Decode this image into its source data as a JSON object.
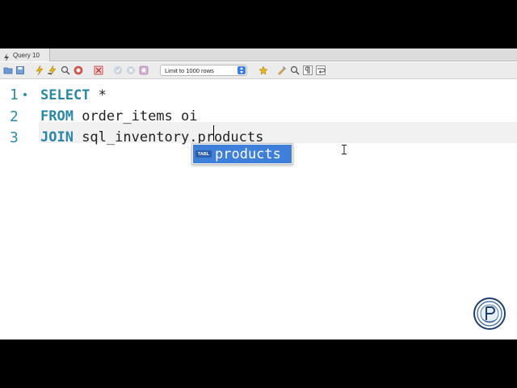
{
  "tab": {
    "label": "Query 10"
  },
  "toolbar": {
    "limit_value": "Limit to 1000 rows",
    "icons": [
      "folder-open-icon",
      "save-icon",
      "execute-icon",
      "execute-line-icon",
      "explain-icon",
      "stop-icon",
      "toggle-error-icon",
      "commit-icon",
      "rollback-icon",
      "autocommit-icon",
      "beautify-icon",
      "find-icon",
      "invisibles-icon",
      "wrap-icon",
      "bookmark-icon"
    ]
  },
  "editor": {
    "line_numbers": [
      "1",
      "2",
      "3"
    ],
    "lines": [
      {
        "keyword": "SELECT",
        "rest": " *"
      },
      {
        "keyword": "FROM",
        "rest": " order_items oi"
      },
      {
        "keyword": "JOIN",
        "rest": " sql_inventory.products"
      }
    ]
  },
  "autocomplete": {
    "badge": "TABL",
    "item": "products"
  },
  "colors": {
    "keyword": "#2a87a6",
    "selection": "#3d7fd9",
    "line_number": "#2c8ba6"
  }
}
